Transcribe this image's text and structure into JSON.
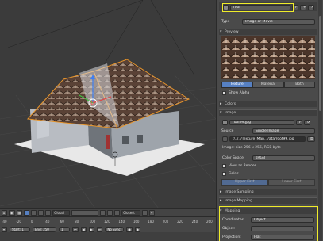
{
  "viewport": {
    "header": {
      "menu_items": [
        "⌂",
        "◉",
        "▦",
        "▾"
      ],
      "orientation": "Global",
      "snap_mode": "Closest"
    }
  },
  "timeline": {
    "ruler_numbers": [
      "-40",
      "-20",
      "0",
      "40",
      "60",
      "80",
      "100",
      "120",
      "140",
      "160",
      "180",
      "200",
      "220",
      "240",
      "260"
    ],
    "start_label": "Start: 1",
    "end_label": "End: 250",
    "current_frame": "1",
    "sync_mode": "No Sync"
  },
  "properties": {
    "texture_name": "roof",
    "type_label": "Type",
    "type_value": "Image or Movie",
    "preview_label": "Preview",
    "tabs": [
      "Texture",
      "Material",
      "Both"
    ],
    "show_alpha": "Show Alpha",
    "colors_label": "Colors",
    "image_label": "Image",
    "image_name": "roof99.jpg",
    "source_label": "Source",
    "source_value": "Single Image",
    "filepath": "//../../Texture_Map.../ata/roof99.jpg",
    "image_info": "Image: size 256 x 256, RGB byte",
    "color_space_label": "Color Space:",
    "color_space_value": "sRGB",
    "view_as_render": "View as Render",
    "fields_label": "Fields",
    "field_order": [
      "Upper First",
      "Lower First"
    ],
    "image_sampling": "Image Sampling",
    "image_mapping": "Image Mapping",
    "mapping_label": "Mapping",
    "coordinates_label": "Coordinates:",
    "coordinates_value": "Object",
    "object_label": "Object:",
    "projection_label": "Projection:",
    "projection_value": "Flat"
  },
  "colors": {
    "highlight": "#f0ec2a",
    "accent": "#5680c2",
    "selection_outline": "#e8962c"
  }
}
